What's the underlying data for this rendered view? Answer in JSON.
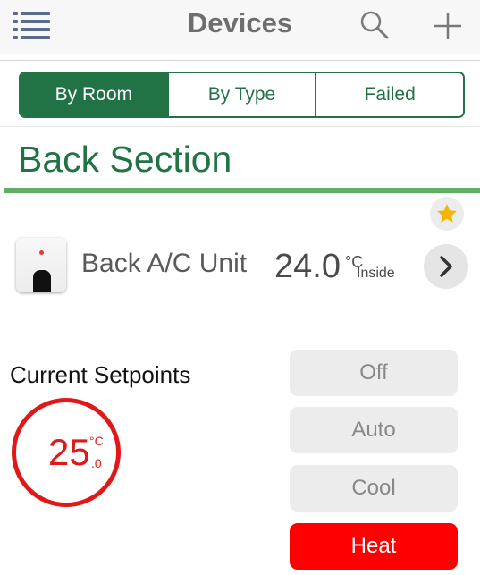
{
  "header": {
    "title": "Devices",
    "icons": {
      "menu": "menu-list-icon",
      "search": "search-icon",
      "add": "plus-icon"
    }
  },
  "filter_tabs": [
    {
      "label": "By Room",
      "active": true
    },
    {
      "label": "By Type",
      "active": false
    },
    {
      "label": "Failed",
      "active": false
    }
  ],
  "section": {
    "title": "Back Section"
  },
  "device": {
    "name": "Back A/C Unit",
    "temperature": "24.0",
    "unit": "°C",
    "label": "Inside",
    "favorite": true,
    "thumbnail_icon": "ac-controller-icon"
  },
  "setpoints": {
    "title": "Current Setpoints",
    "value": "25",
    "decimal": ".0",
    "unit": "°C"
  },
  "modes": [
    {
      "label": "Off",
      "active": false
    },
    {
      "label": "Auto",
      "active": false
    },
    {
      "label": "Cool",
      "active": false
    },
    {
      "label": "Heat",
      "active": true
    }
  ],
  "colors": {
    "brand_green": "#217346",
    "section_rule": "#5fae62",
    "heat_red": "#ff0000",
    "setpoint_red": "#e01818",
    "star_gold": "#f5b400"
  }
}
